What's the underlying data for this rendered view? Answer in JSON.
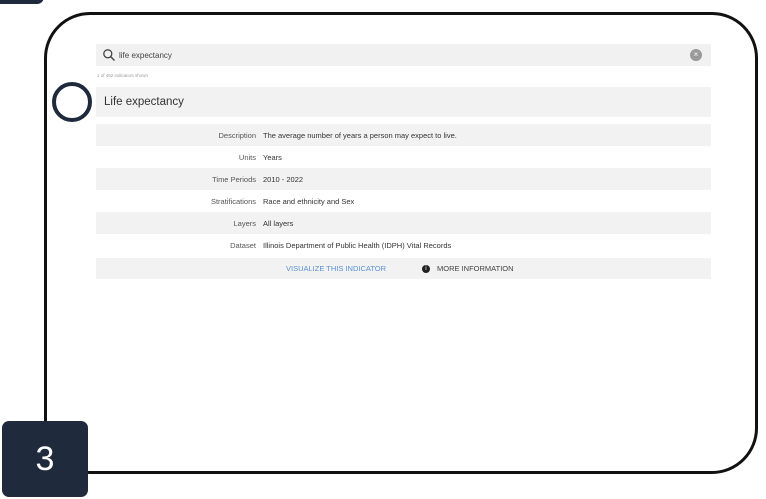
{
  "step": {
    "number": "3"
  },
  "search": {
    "query": "life expectancy",
    "result_count": "1 of 492 indicators shown",
    "clear_icon": "×"
  },
  "indicator": {
    "title": "Life expectancy",
    "details": [
      {
        "label": "Description",
        "value": "The average number of years a person may expect to live."
      },
      {
        "label": "Units",
        "value": "Years"
      },
      {
        "label": "Time Periods",
        "value": "2010 - 2022"
      },
      {
        "label": "Stratifications",
        "value": "Race and ethnicity and Sex"
      },
      {
        "label": "Layers",
        "value": "All layers"
      },
      {
        "label": "Dataset",
        "value": "Illinois Department of Public Health (IDPH) Vital Records"
      }
    ],
    "actions": {
      "visualize": "VISUALIZE THIS INDICATOR",
      "more_info": "MORE INFORMATION",
      "info_icon": "i"
    }
  },
  "colors": {
    "accent_navy": "#1f2a3c",
    "link_blue": "#5a8fd6",
    "row_gray": "#f2f2f2"
  },
  "icons": [
    "search-icon",
    "clear-icon",
    "info-icon"
  ]
}
